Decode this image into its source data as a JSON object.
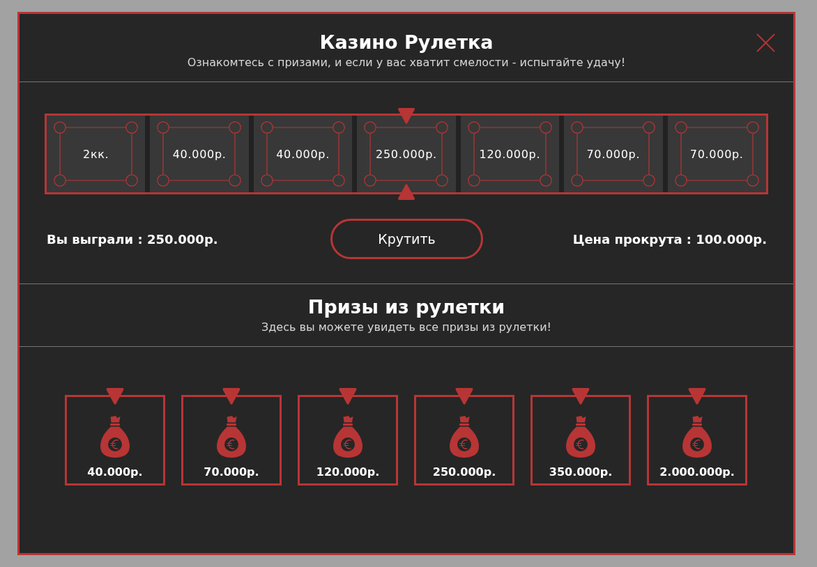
{
  "dialog": {
    "title": "Казино Рулетка",
    "subtitle": "Ознакомтесь с призами, и если у вас хватит смелости - испытайте удачу!"
  },
  "roulette": {
    "cells": [
      {
        "label": "2кк.",
        "selected": false
      },
      {
        "label": "40.000р.",
        "selected": false
      },
      {
        "label": "40.000р.",
        "selected": false
      },
      {
        "label": "250.000р.",
        "selected": true
      },
      {
        "label": "120.000р.",
        "selected": false
      },
      {
        "label": "70.000р.",
        "selected": false
      },
      {
        "label": "70.000р.",
        "selected": false
      }
    ],
    "winnings": "Вы выграли : 250.000р.",
    "spin_button": "Крутить",
    "spin_price": "Цена прокрута : 100.000р."
  },
  "prizes": {
    "title": "Призы из рулетки",
    "subtitle": "Здесь вы можете увидеть все призы из рулетки!",
    "items": [
      {
        "label": "40.000р."
      },
      {
        "label": "70.000р."
      },
      {
        "label": "120.000р."
      },
      {
        "label": "250.000р."
      },
      {
        "label": "350.000р."
      },
      {
        "label": "2.000.000р."
      }
    ]
  }
}
